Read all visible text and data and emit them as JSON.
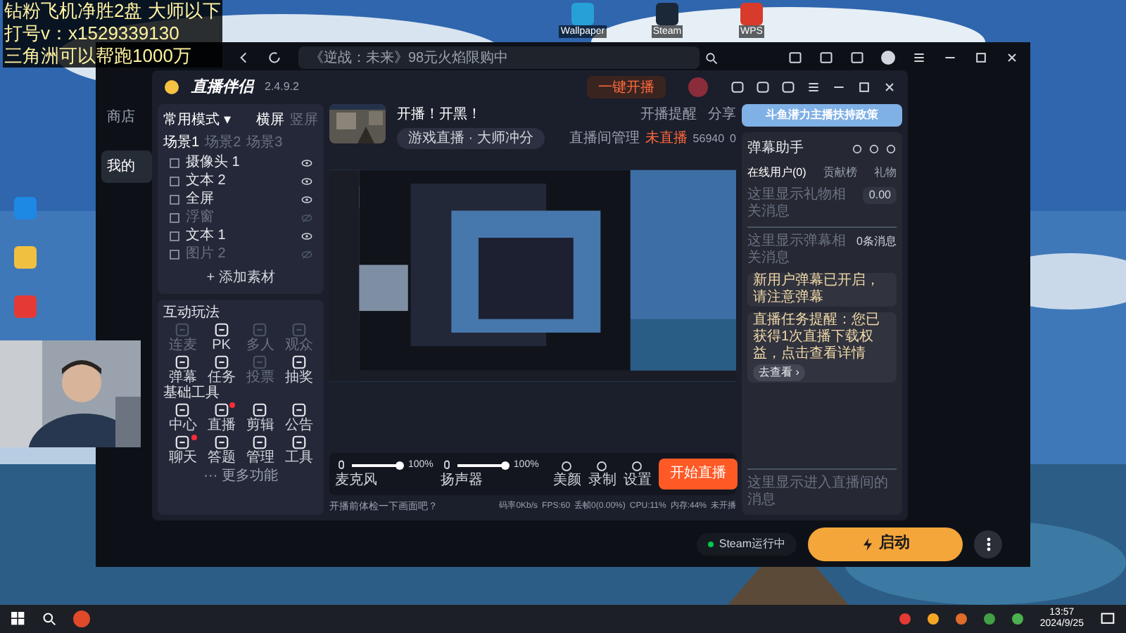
{
  "overlay_text": [
    "钻粉飞机净胜2盘 大师以下",
    "打号v：x1529339130",
    "三角洲可以帮跑1000万"
  ],
  "desktop_icons": [
    {
      "label": "Wallpaper"
    },
    {
      "label": "Steam"
    },
    {
      "label": "WPS"
    }
  ],
  "launcher": {
    "search": {
      "placeholder": "《逆战：未来》98元火焰限购中"
    },
    "sidebar": [
      {
        "label": "商店",
        "selected": false
      },
      {
        "label": "我的",
        "selected": true
      }
    ],
    "status": "Steam运行中",
    "start_button": "启动"
  },
  "app": {
    "title": "直播伴侣",
    "version": "2.4.9.2",
    "top_button": "一键开播",
    "scene": {
      "mode": "常用模式 ▾",
      "orientation": [
        {
          "label": "横屏",
          "selected": true
        },
        {
          "label": "竖屏",
          "selected": false
        }
      ],
      "tabs": [
        {
          "label": "场景1",
          "selected": true
        },
        {
          "label": "场景2",
          "selected": false
        },
        {
          "label": "场景3",
          "selected": false
        }
      ],
      "sources": [
        {
          "label": "摄像头 1",
          "visible": true
        },
        {
          "label": "文本 2",
          "visible": true
        },
        {
          "label": "全屏",
          "visible": true
        },
        {
          "label": "浮窗",
          "visible": false
        },
        {
          "label": "文本 1",
          "visible": true
        },
        {
          "label": "图片 2",
          "visible": false
        }
      ],
      "add_button": "+ 添加素材"
    },
    "tool_groups": [
      {
        "title": "互动玩法",
        "items": [
          {
            "label": "连麦",
            "disabled": true,
            "badge": false
          },
          {
            "label": "PK",
            "disabled": false,
            "badge": false
          },
          {
            "label": "多人",
            "disabled": true,
            "badge": false
          },
          {
            "label": "观众",
            "disabled": true,
            "badge": false
          },
          {
            "label": "弹幕",
            "disabled": false,
            "badge": false
          },
          {
            "label": "任务",
            "disabled": false,
            "badge": false
          },
          {
            "label": "投票",
            "disabled": true,
            "badge": false
          },
          {
            "label": "抽奖",
            "disabled": false,
            "badge": false
          }
        ]
      },
      {
        "title": "基础工具",
        "items": [
          {
            "label": "中心",
            "disabled": false,
            "badge": false
          },
          {
            "label": "直播",
            "disabled": false,
            "badge": true
          },
          {
            "label": "剪辑",
            "disabled": false,
            "badge": false
          },
          {
            "label": "公告",
            "disabled": false,
            "badge": false
          },
          {
            "label": "聊天",
            "disabled": false,
            "badge": true
          },
          {
            "label": "答题",
            "disabled": false,
            "badge": false
          },
          {
            "label": "管理",
            "disabled": false,
            "badge": false
          },
          {
            "label": "工具",
            "disabled": false,
            "badge": false
          }
        ]
      }
    ],
    "more_tools": "··· 更多功能",
    "stream": {
      "title": "开播！开黑！",
      "tag": "游戏直播 · 大师冲分",
      "links": [
        "开播提醒",
        "分享"
      ],
      "room": "直播间管理",
      "state": "未直播",
      "hot": "56940",
      "likes": "0"
    },
    "audio": [
      {
        "label": "麦克风",
        "reading": "100%",
        "level": 1
      },
      {
        "label": "扬声器",
        "reading": "100%",
        "level": 1
      }
    ],
    "actions": [
      "美颜",
      "录制",
      "设置"
    ],
    "go_live": "开始直播",
    "hint": "开播前体检一下画面吧？",
    "stats": [
      "码率0Kb/s",
      "FPS:60",
      "丢帧0(0.00%)",
      "CPU:11%",
      "内存:44%",
      "未开播"
    ],
    "banner": "斗鱼潜力主播扶持政策",
    "chat": {
      "title": "弹幕助手",
      "tabs": [
        {
          "label": "在线用户(0)",
          "selected": true
        },
        {
          "label": "贡献榜",
          "selected": false
        },
        {
          "label": "礼物",
          "selected": false
        }
      ],
      "gift_note": "这里显示礼物相关消息",
      "gift_value": "0.00",
      "msg_note": "这里显示弹幕相关消息",
      "msg_count": "0条消息",
      "messages": [
        "新用户弹幕已开启，请注意弹幕",
        "直播任务提醒：您已获得1次直播下载权益，点击查看详情"
      ],
      "more": "去查看 ›",
      "enter_note": "这里显示进入直播间的消息"
    }
  },
  "taskbar": {
    "time": "13:57",
    "date": "2024/9/25"
  }
}
